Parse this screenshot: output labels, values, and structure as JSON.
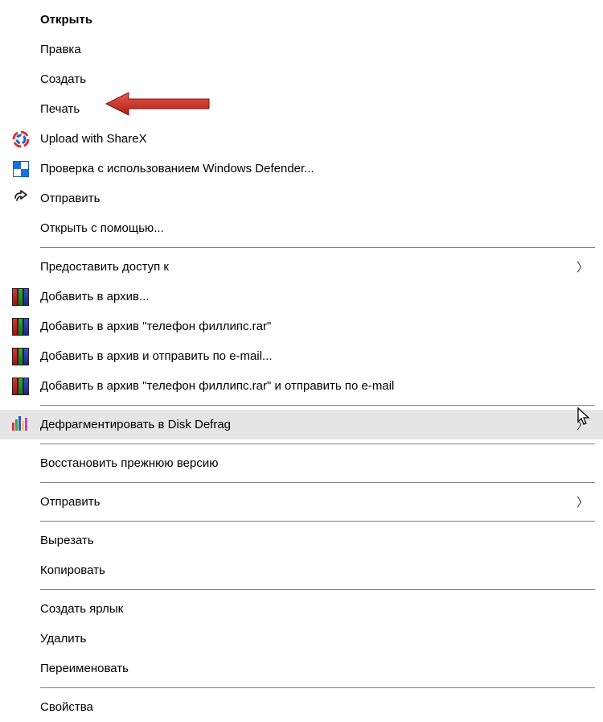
{
  "menu": {
    "items": [
      {
        "label": "Открыть",
        "bold": true,
        "icon": "",
        "sep": false
      },
      {
        "label": "Правка",
        "icon": "",
        "sep": false
      },
      {
        "label": "Создать",
        "icon": "",
        "sep": false
      },
      {
        "label": "Печать",
        "icon": "",
        "arrow_annotation": true,
        "sep": false
      },
      {
        "label": "Upload with ShareX",
        "icon": "sharex",
        "sep": false
      },
      {
        "label": "Проверка с использованием Windows Defender...",
        "icon": "defender",
        "sep": false
      },
      {
        "label": "Отправить",
        "icon": "share",
        "sep": false
      },
      {
        "label": "Открыть с помощью...",
        "icon": "",
        "sep": true
      },
      {
        "label": "Предоставить доступ к",
        "icon": "",
        "submenu": true,
        "sep": false
      },
      {
        "label": "Добавить в архив...",
        "icon": "winrar",
        "sep": false
      },
      {
        "label": "Добавить в архив \"телефон филлипс.rar\"",
        "icon": "winrar",
        "sep": false
      },
      {
        "label": "Добавить в архив и отправить по e-mail...",
        "icon": "winrar",
        "sep": false
      },
      {
        "label": "Добавить в архив \"телефон филлипс.rar\" и отправить по e-mail",
        "icon": "winrar",
        "sep": true
      },
      {
        "label": "Дефрагментировать в Disk Defrag",
        "icon": "defrag",
        "submenu": true,
        "hovered": true,
        "sep": true
      },
      {
        "label": "Восстановить прежнюю версию",
        "icon": "",
        "sep": true
      },
      {
        "label": "Отправить",
        "icon": "",
        "submenu": true,
        "sep": true
      },
      {
        "label": "Вырезать",
        "icon": "",
        "sep": false
      },
      {
        "label": "Копировать",
        "icon": "",
        "sep": true
      },
      {
        "label": "Создать ярлык",
        "icon": "",
        "sep": false
      },
      {
        "label": "Удалить",
        "icon": "",
        "sep": false
      },
      {
        "label": "Переименовать",
        "icon": "",
        "sep": true
      },
      {
        "label": "Свойства",
        "icon": "",
        "sep": false
      }
    ]
  }
}
